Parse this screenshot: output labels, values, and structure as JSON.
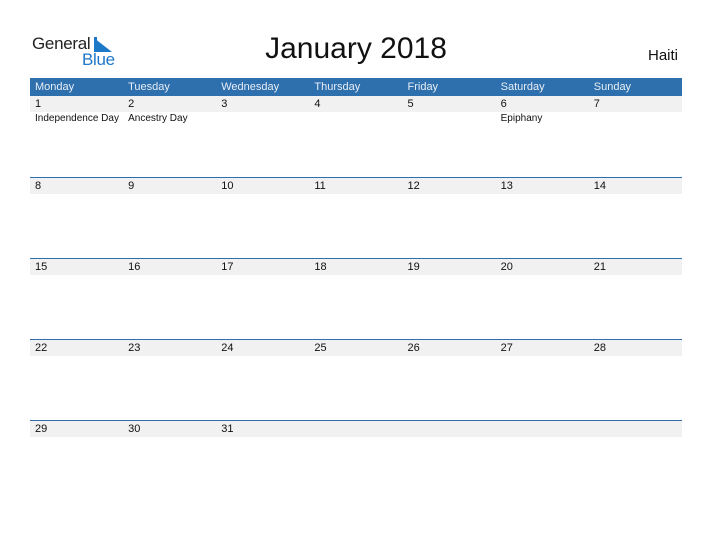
{
  "logo": {
    "line1": "General",
    "line2": "Blue"
  },
  "title": "January 2018",
  "country": "Haiti",
  "weekdays": [
    "Monday",
    "Tuesday",
    "Wednesday",
    "Thursday",
    "Friday",
    "Saturday",
    "Sunday"
  ],
  "weeks": [
    {
      "days": [
        {
          "num": "1",
          "holiday": "Independence Day"
        },
        {
          "num": "2",
          "holiday": "Ancestry Day"
        },
        {
          "num": "3",
          "holiday": ""
        },
        {
          "num": "4",
          "holiday": ""
        },
        {
          "num": "5",
          "holiday": ""
        },
        {
          "num": "6",
          "holiday": "Epiphany"
        },
        {
          "num": "7",
          "holiday": ""
        }
      ]
    },
    {
      "days": [
        {
          "num": "8",
          "holiday": ""
        },
        {
          "num": "9",
          "holiday": ""
        },
        {
          "num": "10",
          "holiday": ""
        },
        {
          "num": "11",
          "holiday": ""
        },
        {
          "num": "12",
          "holiday": ""
        },
        {
          "num": "13",
          "holiday": ""
        },
        {
          "num": "14",
          "holiday": ""
        }
      ]
    },
    {
      "days": [
        {
          "num": "15",
          "holiday": ""
        },
        {
          "num": "16",
          "holiday": ""
        },
        {
          "num": "17",
          "holiday": ""
        },
        {
          "num": "18",
          "holiday": ""
        },
        {
          "num": "19",
          "holiday": ""
        },
        {
          "num": "20",
          "holiday": ""
        },
        {
          "num": "21",
          "holiday": ""
        }
      ]
    },
    {
      "days": [
        {
          "num": "22",
          "holiday": ""
        },
        {
          "num": "23",
          "holiday": ""
        },
        {
          "num": "24",
          "holiday": ""
        },
        {
          "num": "25",
          "holiday": ""
        },
        {
          "num": "26",
          "holiday": ""
        },
        {
          "num": "27",
          "holiday": ""
        },
        {
          "num": "28",
          "holiday": ""
        }
      ]
    },
    {
      "days": [
        {
          "num": "29",
          "holiday": ""
        },
        {
          "num": "30",
          "holiday": ""
        },
        {
          "num": "31",
          "holiday": ""
        },
        {
          "num": "",
          "holiday": ""
        },
        {
          "num": "",
          "holiday": ""
        },
        {
          "num": "",
          "holiday": ""
        },
        {
          "num": "",
          "holiday": ""
        }
      ]
    }
  ],
  "colors": {
    "header_bg": "#2e6fad",
    "brand_blue": "#1e78c8",
    "date_strip": "#f1f1f1"
  }
}
